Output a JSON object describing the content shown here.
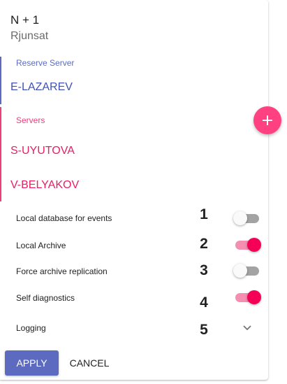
{
  "header": {
    "title": "N + 1",
    "subtitle": "Rjunsat"
  },
  "reserve": {
    "label": "Reserve Server",
    "server": "E-LAZAREV",
    "accent": "#5c6bc0"
  },
  "servers": {
    "label": "Servers",
    "items": [
      "S-UYUTOVA",
      "V-BELYAKOV"
    ],
    "accent": "#e91e63"
  },
  "add_button": {
    "icon": "plus-icon",
    "color": "#ff4081"
  },
  "options": [
    {
      "label": "Local database for events",
      "number": "1",
      "control": "toggle",
      "on": false
    },
    {
      "label": "Local Archive",
      "number": "2",
      "control": "toggle",
      "on": true
    },
    {
      "label": "Force archive replication",
      "number": "3",
      "control": "toggle",
      "on": false
    },
    {
      "label": "Self diagnostics",
      "number": "4",
      "control": "toggle",
      "on": true
    },
    {
      "label": "Logging",
      "number": "5",
      "control": "expand",
      "icon": "chevron-down-icon"
    }
  ],
  "actions": {
    "apply_label": "APPLY",
    "cancel_label": "CANCEL",
    "apply_color": "#5c6bc0"
  }
}
